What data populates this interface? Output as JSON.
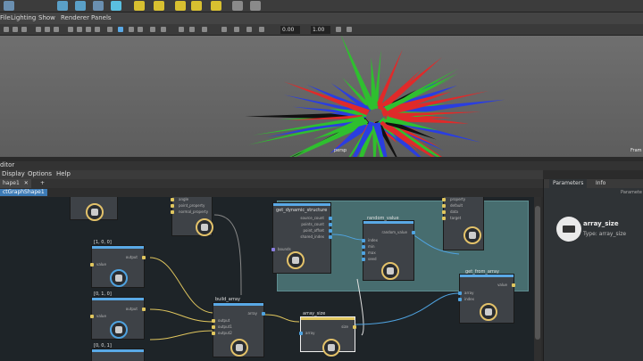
{
  "menubar": {
    "items": [
      "File",
      "Lighting",
      "Show",
      "Renderer",
      "Panels"
    ]
  },
  "viewport_toolbar": {
    "field1": "0.00",
    "field2": "1.00"
  },
  "viewport": {
    "camera_label": "persp",
    "frame_label": "Fram"
  },
  "editor": {
    "title": "ditor",
    "menu": [
      "Display",
      "Options",
      "Help"
    ],
    "tab_label": "hape1",
    "tab_close": "✕",
    "tab_add": "+",
    "breadcrumb": "ctGraphShape1"
  },
  "nodes": {
    "top_left": {
      "ports": [
        "angle",
        "point_property",
        "normal_property"
      ]
    },
    "get_geo": {
      "title": "get_dynamic_structure",
      "ports": [
        "source_count",
        "points_count",
        "point_offset",
        "shared_index"
      ],
      "out": [
        "bounds"
      ]
    },
    "random_value": {
      "title": "random_value",
      "ports": [
        "index",
        "min",
        "max",
        "seed"
      ],
      "out": [
        "random_value"
      ]
    },
    "props": {
      "ports": [
        "property",
        "default",
        "data",
        "target"
      ]
    },
    "get_from_array": {
      "title": "get_from_array",
      "ports": [
        "array",
        "index"
      ],
      "out": [
        "value"
      ]
    },
    "value1": {
      "title": "[1, 0, 0]",
      "in": "value",
      "out": "output"
    },
    "value2": {
      "title": "[0, 1, 0]",
      "in": "value",
      "out": "output"
    },
    "value3": {
      "title": "[0, 0, 1]"
    },
    "build_array": {
      "title": "build_array",
      "ports": [
        "output",
        "output1",
        "output2"
      ],
      "out": "array"
    },
    "array_size": {
      "title": "array_size",
      "in": "array",
      "out": "size"
    }
  },
  "right_panel": {
    "tabs": [
      "Parameters",
      "Info"
    ],
    "params_label": "Paramete",
    "node_name": "array_size",
    "node_type": "Type: array_size"
  },
  "colors": {
    "accent": "#3d7bb6",
    "red": "#e02a2a",
    "green": "#2fbf2f",
    "blue": "#2a3ee0",
    "group": "#4f7a7c"
  }
}
